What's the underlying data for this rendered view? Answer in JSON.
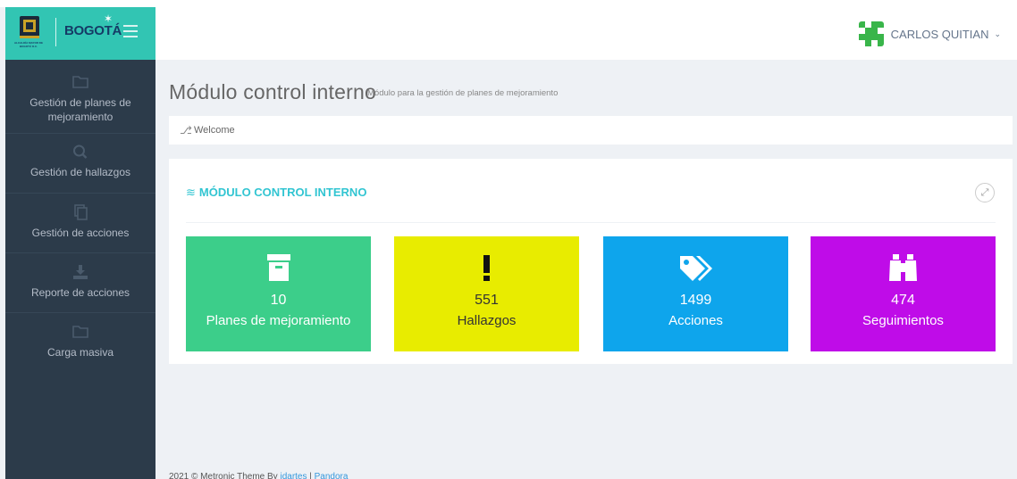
{
  "logo": {
    "text": "BOGOTÁ",
    "caption": "ALCALDÍA MAYOR DE BOGOTÁ D.C."
  },
  "header": {
    "user_name": "CARLOS QUITIAN",
    "avatar_color": "#39b54a"
  },
  "sidebar": {
    "items": [
      {
        "icon": "folder-icon",
        "label": "Gestión de planes de mejoramiento"
      },
      {
        "icon": "search-icon",
        "label": "Gestión de hallazgos"
      },
      {
        "icon": "copy-icon",
        "label": "Gestión de acciones"
      },
      {
        "icon": "download-icon",
        "label": "Reporte de acciones"
      },
      {
        "icon": "folder-icon",
        "label": "Carga masiva"
      }
    ]
  },
  "page": {
    "title": "Módulo control interno",
    "subtitle": "Módulo para la gestión de planes de mejoramiento"
  },
  "breadcrumb": {
    "label": "Welcome"
  },
  "portlet": {
    "title": "MÓDULO CONTROL INTERNO",
    "accent": "#32c5d2",
    "tiles": [
      {
        "icon": "archive-icon",
        "number": "10",
        "label": "Planes de mejoramiento",
        "color": "#3cce8a"
      },
      {
        "icon": "exclamation-icon",
        "number": "551",
        "label": "Hallazgos",
        "color": "#e8ec00"
      },
      {
        "icon": "tags-icon",
        "number": "1499",
        "label": "Acciones",
        "color": "#0ea5ec"
      },
      {
        "icon": "binoculars-icon",
        "number": "474",
        "label": "Seguimientos",
        "color": "#bf0ce8"
      }
    ]
  },
  "footer": {
    "text": "2021 © Metronic Theme By ",
    "link1": "idartes",
    "separator": " | ",
    "link2": "Pandora"
  }
}
